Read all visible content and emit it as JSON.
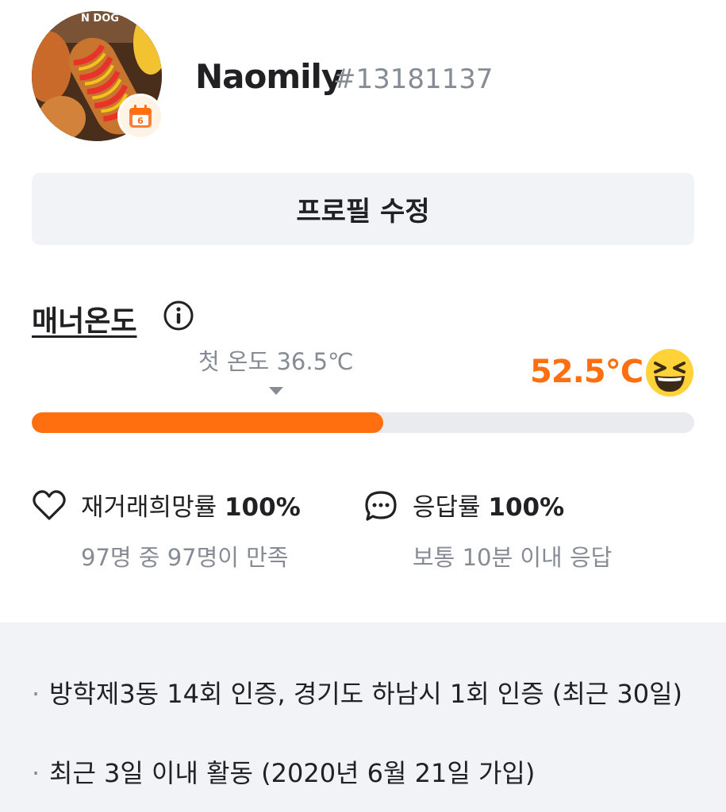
{
  "profile": {
    "nickname": "Naomily",
    "user_id": "#13181137",
    "avatar_text": "N DOG",
    "badge_icon": "calendar-icon"
  },
  "edit_button": {
    "label": "프로필 수정"
  },
  "manner": {
    "title": "매너온도",
    "info_icon": "info-icon",
    "first_temp_label": "첫 온도 36.5℃",
    "current_temp": "52.5℃",
    "current_value": 52.5,
    "bar_fill_fraction": 0.53,
    "emoji": "grinning-squinting-face-icon",
    "accent_color": "#ff6f0f"
  },
  "stats": {
    "retrade": {
      "icon": "heart-icon",
      "label": "재거래희망률",
      "value": "100%",
      "sub": "97명 중 97명이 만족"
    },
    "response": {
      "icon": "chat-bubble-icon",
      "label": "응답률",
      "value": "100%",
      "sub": "보통 10분 이내 응답"
    }
  },
  "activity": {
    "lines": [
      "방학제3동 14회 인증, 경기도 하남시 1회 인증 (최근 30일)",
      "최근 3일 이내 활동 (2020년 6월 21일 가입)"
    ]
  }
}
